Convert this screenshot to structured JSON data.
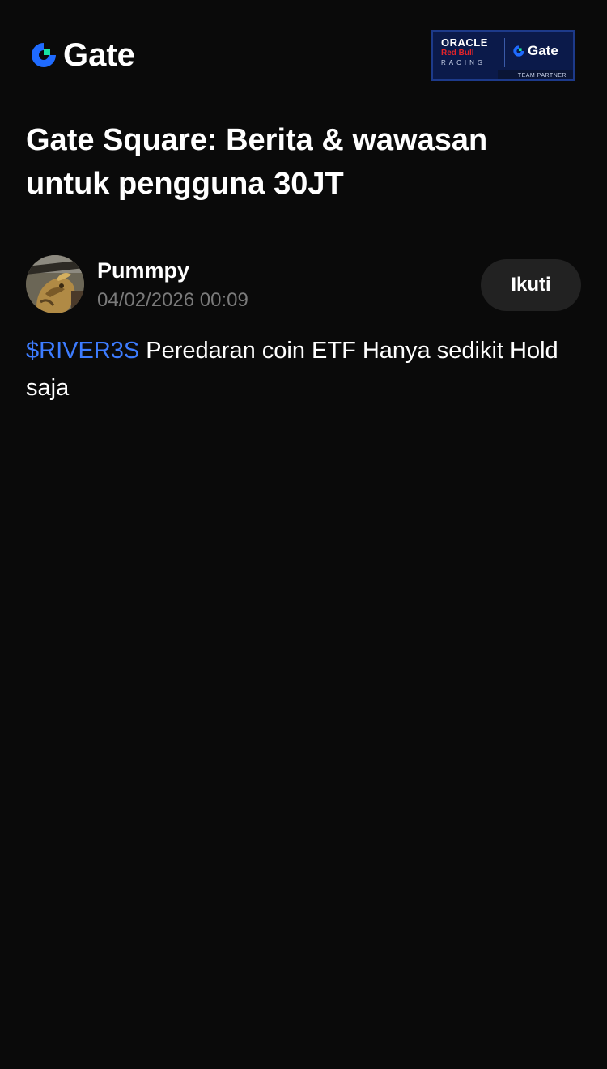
{
  "header": {
    "logo_text": "Gate",
    "logo_icon": "gate-logo-icon",
    "partner_badge": {
      "oracle": "ORACLE",
      "redbull": "Red Bull",
      "racing": "RACING",
      "gate": "Gate",
      "team_partner": "TEAM PARTNER"
    }
  },
  "page": {
    "title": "Gate Square: Berita & wawasan untuk pengguna 30JT"
  },
  "post": {
    "author": "Pummpy",
    "timestamp": "04/02/2026 00:09",
    "follow_label": "Ikuti",
    "ticker": "$RIVER3S",
    "body": " Peredaran coin ETF Hanya sedikit Hold saja"
  },
  "colors": {
    "background": "#0a0a0a",
    "accent_blue": "#3d7cff",
    "brand_blue": "#1f6bff",
    "brand_green": "#17e6a1",
    "muted_text": "#7a7a7a",
    "button_bg": "#222222"
  }
}
